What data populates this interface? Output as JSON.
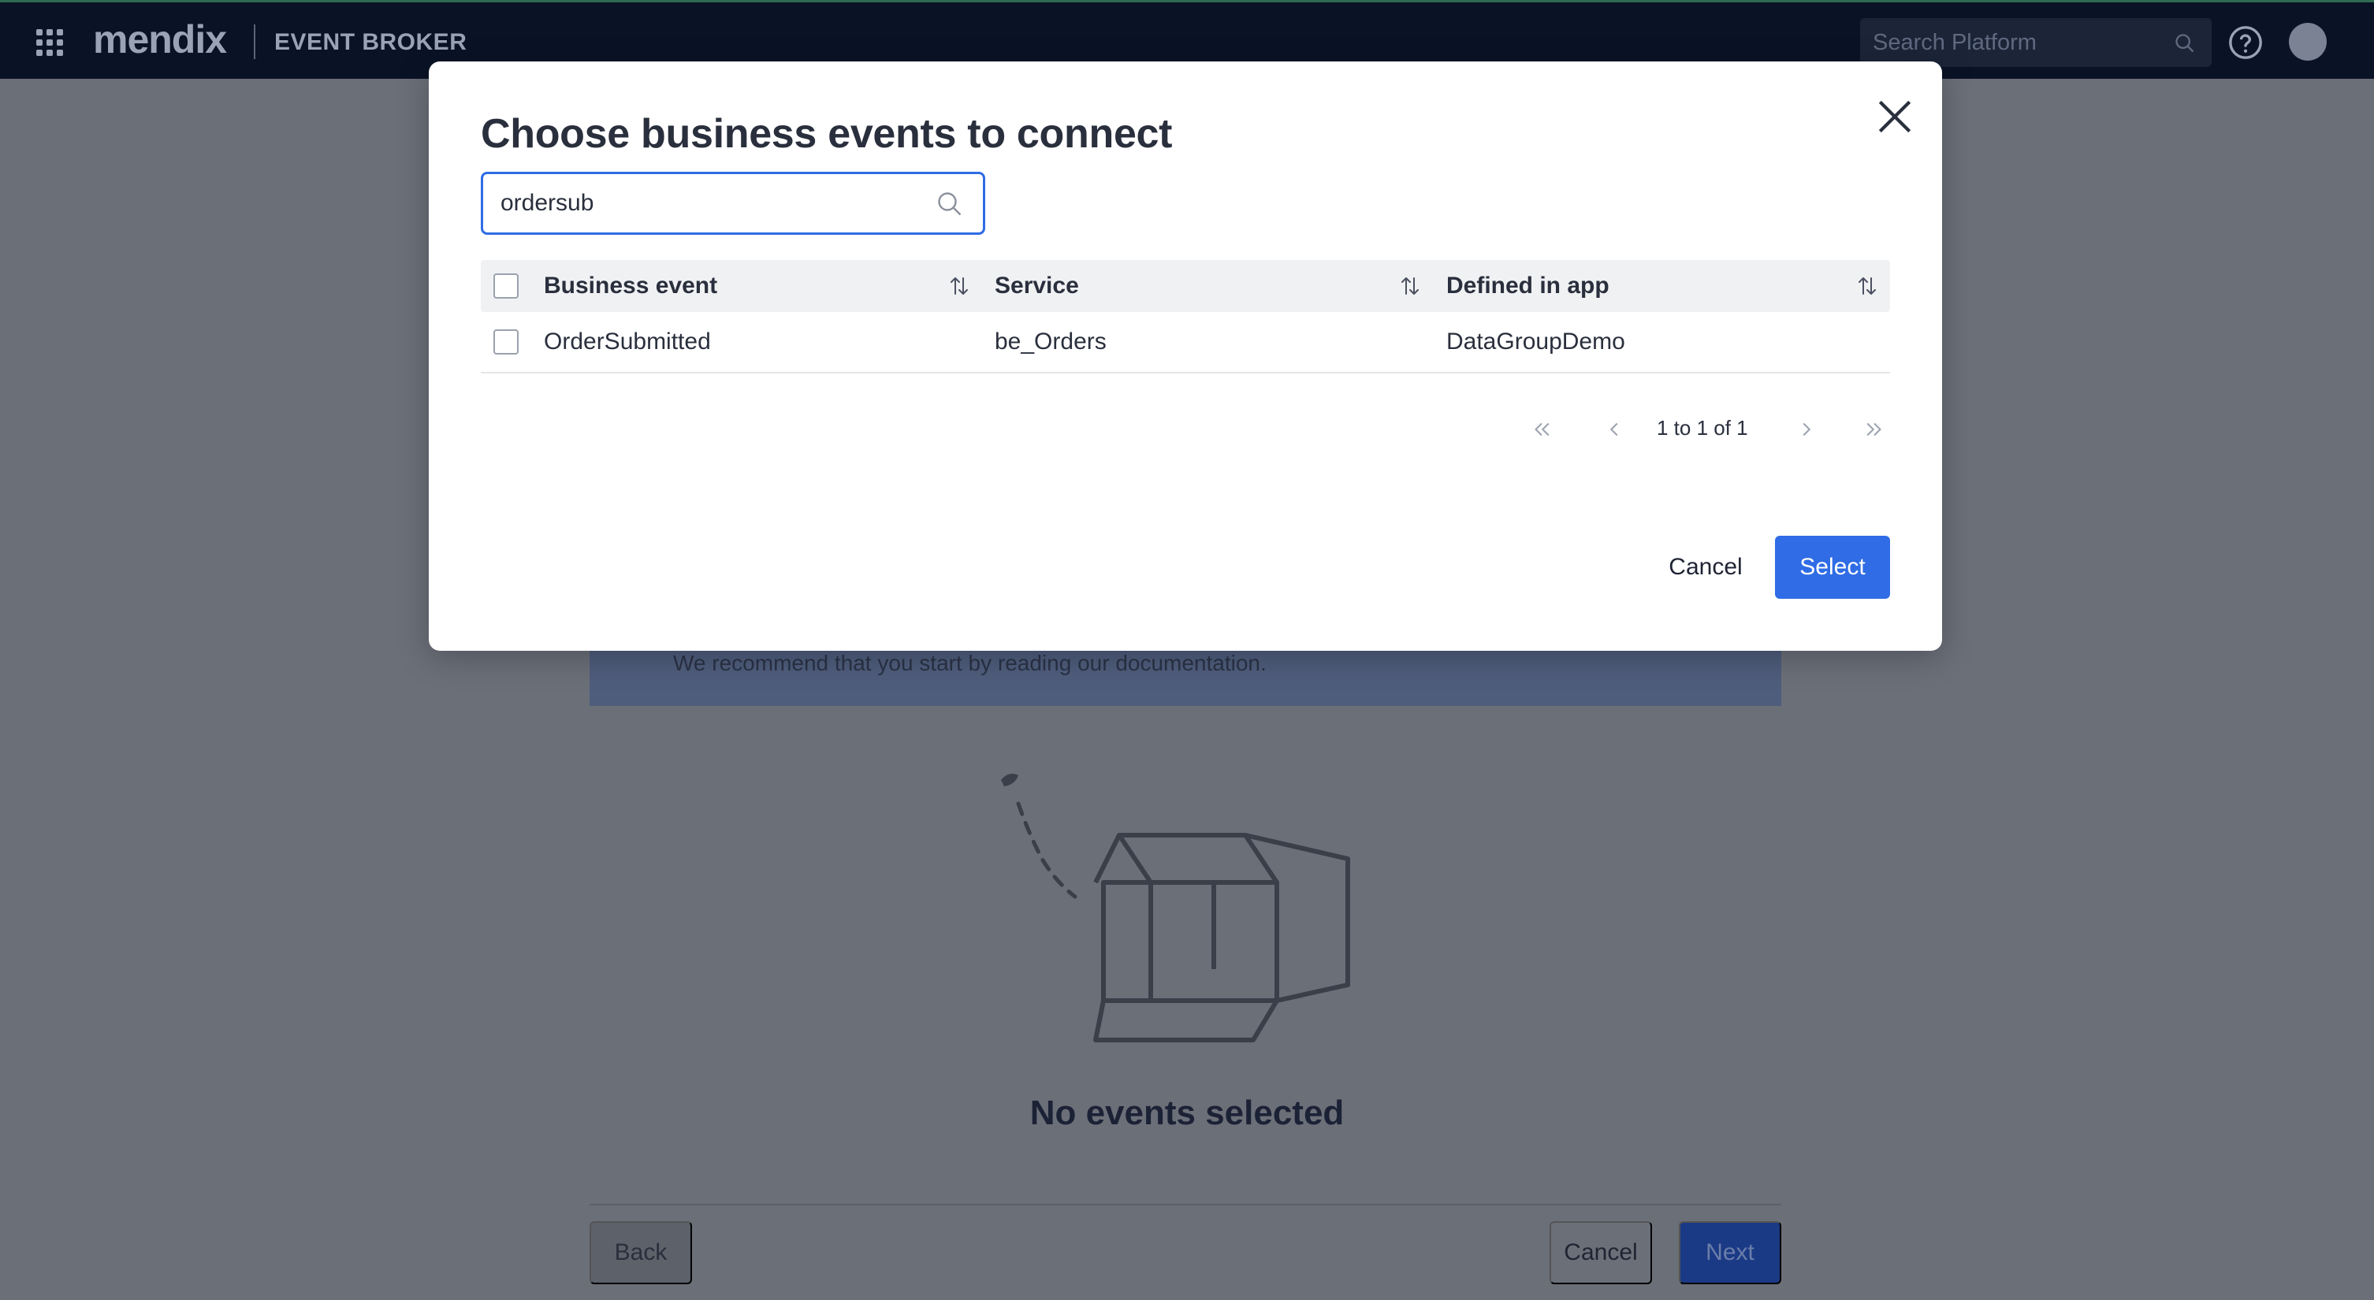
{
  "topbar": {
    "logo": "mendix",
    "product": "EVENT BROKER",
    "search_placeholder": "Search Platform"
  },
  "background": {
    "info_text": "We recommend that you start by reading our documentation.",
    "empty_title": "No events selected",
    "back_label": "Back",
    "cancel_label": "Cancel",
    "next_label": "Next"
  },
  "modal": {
    "title": "Choose business events to connect",
    "search_value": "ordersub",
    "columns": [
      "Business event",
      "Service",
      "Defined in app"
    ],
    "rows": [
      {
        "event": "OrderSubmitted",
        "service": "be_Orders",
        "app": "DataGroupDemo"
      }
    ],
    "pager_text": "1 to 1 of 1",
    "cancel_label": "Cancel",
    "select_label": "Select"
  },
  "colors": {
    "accent": "#2f6ce5",
    "topbar": "#0a1326"
  }
}
